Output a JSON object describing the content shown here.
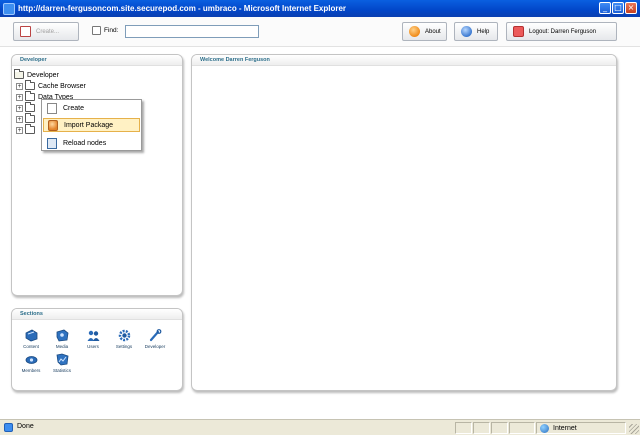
{
  "window": {
    "title": "http://darren-fergusoncom.site.securepod.com - umbraco - Microsoft Internet Explorer",
    "min_glyph": "_",
    "max_glyph": "□",
    "close_glyph": "×"
  },
  "toolbar": {
    "create_label": "Create...",
    "find_label": "Find:",
    "find_value": "",
    "about_label": "About",
    "help_label": "Help",
    "logout_label": "Logout: Darren Ferguson"
  },
  "tree_panel": {
    "title": "Developer",
    "root": "Developer",
    "items": [
      {
        "label": "Cache Browser",
        "expander": "+"
      },
      {
        "label": "Data Types",
        "expander": "+"
      },
      {
        "label": "",
        "expander": "+"
      },
      {
        "label": "",
        "expander": "+"
      },
      {
        "label": "",
        "expander": "+"
      }
    ]
  },
  "context_menu": {
    "items": [
      {
        "label": "Create",
        "icon": "create-icon",
        "hover": false
      },
      {
        "label": "Import Package",
        "icon": "package-icon",
        "hover": true
      },
      {
        "label": "Reload nodes",
        "icon": "reload-icon",
        "hover": false
      }
    ]
  },
  "main_panel": {
    "title": "Welcome Darren Ferguson"
  },
  "sections_panel": {
    "title": "Sections",
    "items": [
      {
        "label": "Content",
        "icon": "content-icon"
      },
      {
        "label": "Media",
        "icon": "media-icon"
      },
      {
        "label": "Users",
        "icon": "users-icon"
      },
      {
        "label": "Settings",
        "icon": "settings-icon"
      },
      {
        "label": "Developer",
        "icon": "developer-icon"
      },
      {
        "label": "Members",
        "icon": "members-icon"
      },
      {
        "label": "Statistics",
        "icon": "statistics-icon"
      }
    ]
  },
  "statusbar": {
    "status": "Done",
    "zone": "Internet"
  },
  "colors": {
    "titlebar": "#0246c8",
    "panel_title": "#2c6e8a",
    "section_icon": "#1f5aa0",
    "menu_hover": "#fff1c4"
  }
}
